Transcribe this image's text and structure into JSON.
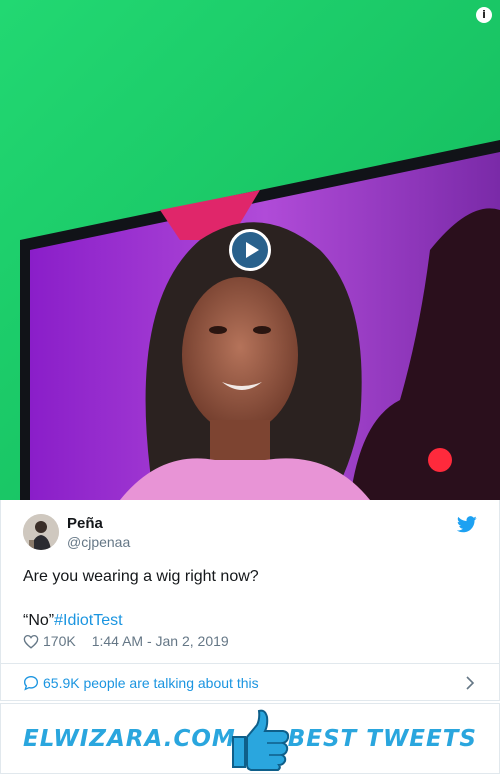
{
  "tweet": {
    "display_name": "Peña",
    "handle": "@cjpenaa",
    "text_line1": "Are you wearing a wig right now?",
    "text_line2_prefix": "“No”",
    "hashtag": "#IdiotTest",
    "like_count": "170K",
    "timestamp": "1:44 AM - Jan 2, 2019",
    "talking_text": "65.9K people are talking about this"
  },
  "banner": {
    "left_text": "ELWIZARA.COM",
    "right_text": "BEST TWEETS"
  },
  "media": {
    "info_symbol": "i"
  },
  "icons": [
    "info-icon",
    "play-icon",
    "twitter-bird-icon",
    "heart-icon",
    "speech-bubble-icon",
    "chevron-right-icon",
    "thumbs-up-icon"
  ],
  "colors": {
    "link": "#1b95e0",
    "text": "#14171a",
    "muted": "#657786",
    "banner_brand": "#2aa6de",
    "twitter_blue": "#1da1f2"
  }
}
